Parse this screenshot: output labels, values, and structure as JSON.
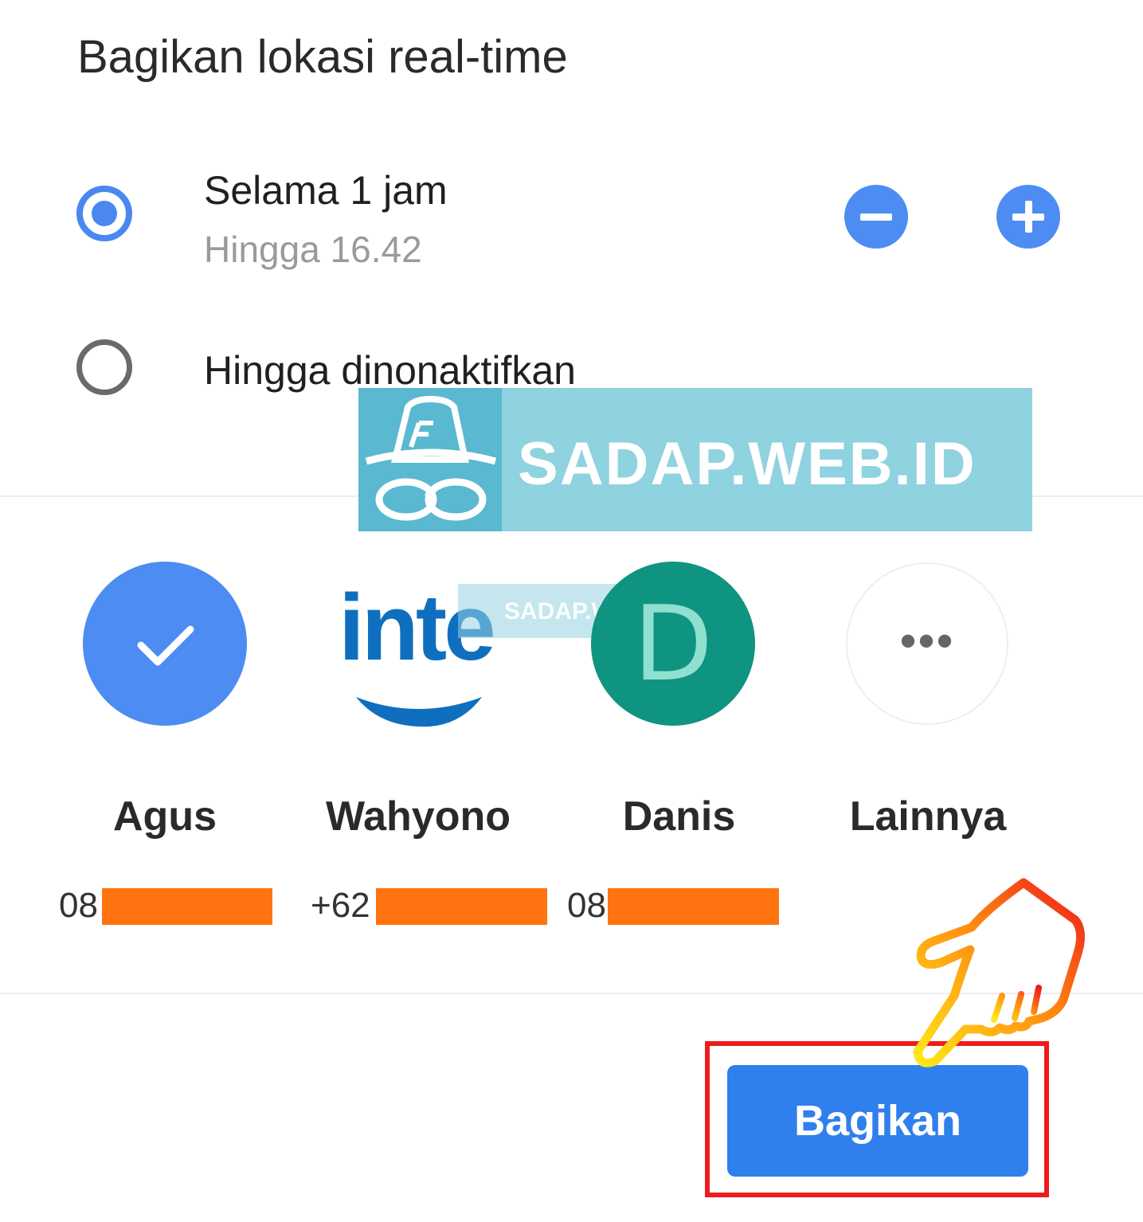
{
  "dialog": {
    "title": "Bagikan lokasi real-time"
  },
  "options": [
    {
      "label": "Selama 1 jam",
      "sublabel": "Hingga 16.42",
      "selected": true
    },
    {
      "label": "Hingga dinonaktifkan",
      "selected": false
    }
  ],
  "duration_controls": {
    "decrease_icon": "minus-icon",
    "increase_icon": "plus-icon"
  },
  "watermark": {
    "text": "SADAP.WEB.ID",
    "small_text": "SADAP.WEB.ID"
  },
  "contacts": [
    {
      "name": "Agus",
      "phone_prefix": "08",
      "avatar": "check-icon",
      "selected": true
    },
    {
      "name": "Wahyono",
      "phone_prefix": "+62",
      "avatar": "inte"
    },
    {
      "name": "Danis",
      "phone_prefix": "08",
      "avatar_letter": "D"
    },
    {
      "name": "Lainnya",
      "avatar": "more-icon"
    }
  ],
  "more_dots": "•••",
  "actions": {
    "share_label": "Bagikan"
  },
  "colors": {
    "accent": "#4d8cf2",
    "share_button": "#2f80ec",
    "danis_avatar": "#0e9480",
    "redaction": "#ff7410",
    "highlight_frame": "#ee1c1c"
  }
}
